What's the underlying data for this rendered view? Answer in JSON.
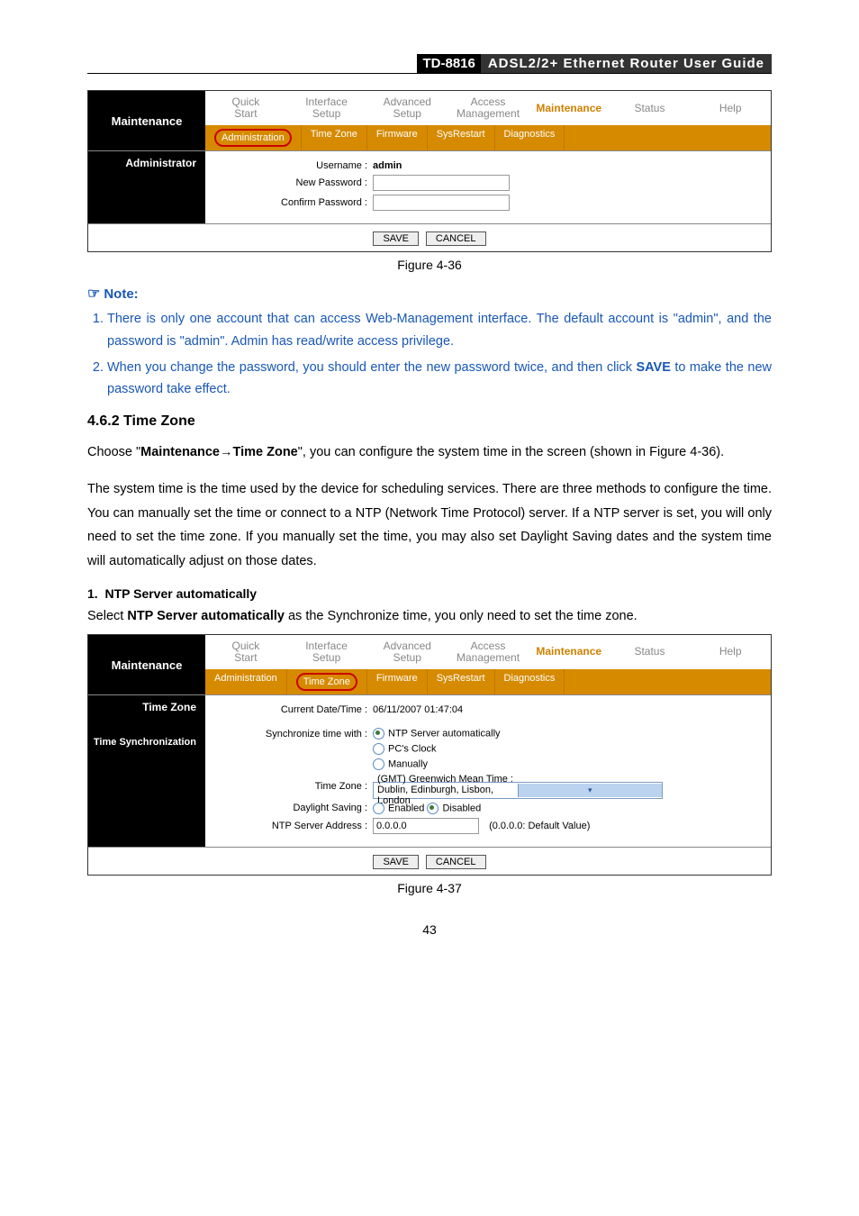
{
  "header": {
    "model": "TD-8816",
    "product": "ADSL2/2+ Ethernet Router User Guide"
  },
  "shot1": {
    "side_title": "Maintenance",
    "tabs1": [
      "Quick\nStart",
      "Interface\nSetup",
      "Advanced\nSetup",
      "Access\nManagement",
      "Maintenance",
      "Status",
      "Help"
    ],
    "tabs2": [
      "Administration",
      "Time Zone",
      "Firmware",
      "SysRestart",
      "Diagnostics"
    ],
    "active1": 4,
    "active2": 0,
    "side_label": "Administrator",
    "rows": {
      "username_label": "Username :",
      "username_value": "admin",
      "newpass_label": "New Password :",
      "confpass_label": "Confirm Password :"
    },
    "buttons": {
      "save": "SAVE",
      "cancel": "CANCEL"
    }
  },
  "fig1": "Figure 4-36",
  "note_title": "Note:",
  "notes": [
    {
      "pre": "There is only one account that can access Web-Management interface. The default account is \"admin\", and the password is \"admin\". Admin has read/write access privilege."
    },
    {
      "pre": "When you change the password, you should enter the new password twice, and then click ",
      "save": "SAVE",
      "post": " to make the new password take effect."
    }
  ],
  "h462": "4.6.2  Time Zone",
  "para1_a": "Choose \"",
  "para1_b": "Maintenance",
  "para1_arrow": "→",
  "para1_c": "Time Zone",
  "para1_d": "\", you can configure the system time in the screen (shown in Figure 4-36).",
  "para2": "The system time is the time used by the device for scheduling services. There are three methods to configure the time. You can manually set the time or connect to a NTP (Network Time Protocol) server. If a NTP server is set, you will only need to set the time zone. If you manually set the time, you may also set Daylight Saving dates and the system time will automatically adjust on those dates.",
  "sub1_num": "1.",
  "sub1": "NTP Server automatically",
  "sub1_line_a": "Select ",
  "sub1_line_b": "NTP Server automatically",
  "sub1_line_c": " as the Synchronize time, you only need to set the time zone.",
  "shot2": {
    "side_title": "Maintenance",
    "tabs1": [
      "Quick\nStart",
      "Interface\nSetup",
      "Advanced\nSetup",
      "Access\nManagement",
      "Maintenance",
      "Status",
      "Help"
    ],
    "tabs2": [
      "Administration",
      "Time Zone",
      "Firmware",
      "SysRestart",
      "Diagnostics"
    ],
    "active1": 4,
    "active2": 1,
    "side_labels": [
      "Time Zone",
      "Time Synchronization"
    ],
    "current_label": "Current Date/Time :",
    "current_value": "06/11/2007 01:47:04",
    "sync_label": "Synchronize time with :",
    "sync_opts": [
      "NTP Server automatically",
      "PC's Clock",
      "Manually"
    ],
    "sync_sel": 0,
    "tz_label": "Time Zone :",
    "tz_value": "(GMT) Greenwich Mean Time : Dublin, Edinburgh, Lisbon, London",
    "ds_label": "Daylight Saving :",
    "ds_opts": [
      "Enabled",
      "Disabled"
    ],
    "ds_sel": 1,
    "ntp_label": "NTP Server Address :",
    "ntp_value": "0.0.0.0",
    "ntp_note": "(0.0.0.0: Default Value)",
    "buttons": {
      "save": "SAVE",
      "cancel": "CANCEL"
    }
  },
  "fig2": "Figure 4-37",
  "page_number": "43"
}
